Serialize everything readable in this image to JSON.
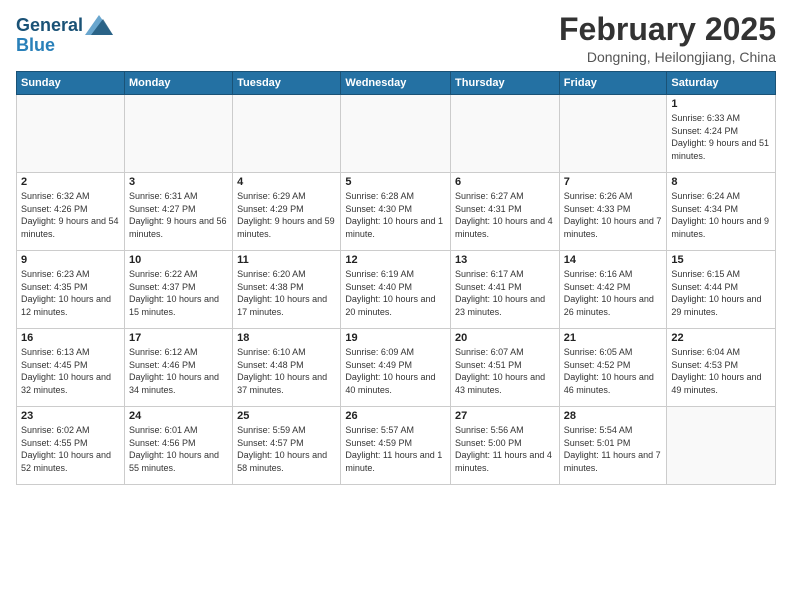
{
  "logo": {
    "line1": "General",
    "line2": "Blue"
  },
  "title": "February 2025",
  "subtitle": "Dongning, Heilongjiang, China",
  "weekdays": [
    "Sunday",
    "Monday",
    "Tuesday",
    "Wednesday",
    "Thursday",
    "Friday",
    "Saturday"
  ],
  "weeks": [
    [
      {
        "day": "",
        "info": ""
      },
      {
        "day": "",
        "info": ""
      },
      {
        "day": "",
        "info": ""
      },
      {
        "day": "",
        "info": ""
      },
      {
        "day": "",
        "info": ""
      },
      {
        "day": "",
        "info": ""
      },
      {
        "day": "1",
        "info": "Sunrise: 6:33 AM\nSunset: 4:24 PM\nDaylight: 9 hours and 51 minutes."
      }
    ],
    [
      {
        "day": "2",
        "info": "Sunrise: 6:32 AM\nSunset: 4:26 PM\nDaylight: 9 hours and 54 minutes."
      },
      {
        "day": "3",
        "info": "Sunrise: 6:31 AM\nSunset: 4:27 PM\nDaylight: 9 hours and 56 minutes."
      },
      {
        "day": "4",
        "info": "Sunrise: 6:29 AM\nSunset: 4:29 PM\nDaylight: 9 hours and 59 minutes."
      },
      {
        "day": "5",
        "info": "Sunrise: 6:28 AM\nSunset: 4:30 PM\nDaylight: 10 hours and 1 minute."
      },
      {
        "day": "6",
        "info": "Sunrise: 6:27 AM\nSunset: 4:31 PM\nDaylight: 10 hours and 4 minutes."
      },
      {
        "day": "7",
        "info": "Sunrise: 6:26 AM\nSunset: 4:33 PM\nDaylight: 10 hours and 7 minutes."
      },
      {
        "day": "8",
        "info": "Sunrise: 6:24 AM\nSunset: 4:34 PM\nDaylight: 10 hours and 9 minutes."
      }
    ],
    [
      {
        "day": "9",
        "info": "Sunrise: 6:23 AM\nSunset: 4:35 PM\nDaylight: 10 hours and 12 minutes."
      },
      {
        "day": "10",
        "info": "Sunrise: 6:22 AM\nSunset: 4:37 PM\nDaylight: 10 hours and 15 minutes."
      },
      {
        "day": "11",
        "info": "Sunrise: 6:20 AM\nSunset: 4:38 PM\nDaylight: 10 hours and 17 minutes."
      },
      {
        "day": "12",
        "info": "Sunrise: 6:19 AM\nSunset: 4:40 PM\nDaylight: 10 hours and 20 minutes."
      },
      {
        "day": "13",
        "info": "Sunrise: 6:17 AM\nSunset: 4:41 PM\nDaylight: 10 hours and 23 minutes."
      },
      {
        "day": "14",
        "info": "Sunrise: 6:16 AM\nSunset: 4:42 PM\nDaylight: 10 hours and 26 minutes."
      },
      {
        "day": "15",
        "info": "Sunrise: 6:15 AM\nSunset: 4:44 PM\nDaylight: 10 hours and 29 minutes."
      }
    ],
    [
      {
        "day": "16",
        "info": "Sunrise: 6:13 AM\nSunset: 4:45 PM\nDaylight: 10 hours and 32 minutes."
      },
      {
        "day": "17",
        "info": "Sunrise: 6:12 AM\nSunset: 4:46 PM\nDaylight: 10 hours and 34 minutes."
      },
      {
        "day": "18",
        "info": "Sunrise: 6:10 AM\nSunset: 4:48 PM\nDaylight: 10 hours and 37 minutes."
      },
      {
        "day": "19",
        "info": "Sunrise: 6:09 AM\nSunset: 4:49 PM\nDaylight: 10 hours and 40 minutes."
      },
      {
        "day": "20",
        "info": "Sunrise: 6:07 AM\nSunset: 4:51 PM\nDaylight: 10 hours and 43 minutes."
      },
      {
        "day": "21",
        "info": "Sunrise: 6:05 AM\nSunset: 4:52 PM\nDaylight: 10 hours and 46 minutes."
      },
      {
        "day": "22",
        "info": "Sunrise: 6:04 AM\nSunset: 4:53 PM\nDaylight: 10 hours and 49 minutes."
      }
    ],
    [
      {
        "day": "23",
        "info": "Sunrise: 6:02 AM\nSunset: 4:55 PM\nDaylight: 10 hours and 52 minutes."
      },
      {
        "day": "24",
        "info": "Sunrise: 6:01 AM\nSunset: 4:56 PM\nDaylight: 10 hours and 55 minutes."
      },
      {
        "day": "25",
        "info": "Sunrise: 5:59 AM\nSunset: 4:57 PM\nDaylight: 10 hours and 58 minutes."
      },
      {
        "day": "26",
        "info": "Sunrise: 5:57 AM\nSunset: 4:59 PM\nDaylight: 11 hours and 1 minute."
      },
      {
        "day": "27",
        "info": "Sunrise: 5:56 AM\nSunset: 5:00 PM\nDaylight: 11 hours and 4 minutes."
      },
      {
        "day": "28",
        "info": "Sunrise: 5:54 AM\nSunset: 5:01 PM\nDaylight: 11 hours and 7 minutes."
      },
      {
        "day": "",
        "info": ""
      }
    ]
  ]
}
